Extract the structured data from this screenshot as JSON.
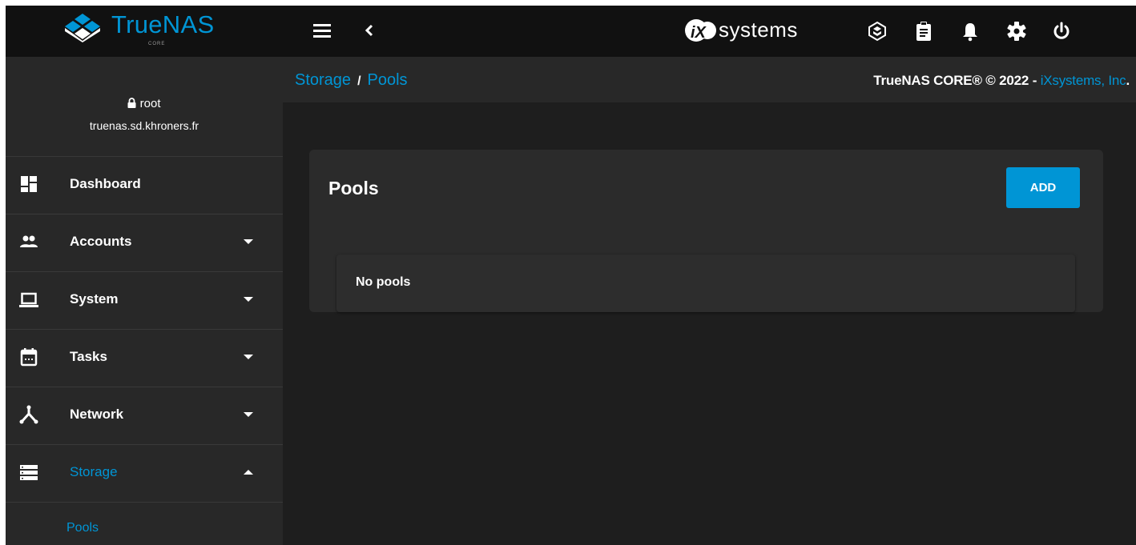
{
  "brand": {
    "name": "TrueNAS",
    "sub": "CORE"
  },
  "vendor_logo": {
    "text": "systems",
    "mark": "iX"
  },
  "topbar_icons": [
    "truecommand-icon",
    "clipboard-icon",
    "bell-icon",
    "gear-icon",
    "power-icon"
  ],
  "user": {
    "name": "root",
    "host": "truenas.sd.khroners.fr"
  },
  "sidebar": {
    "items": [
      {
        "label": "Dashboard",
        "icon": "dashboard-icon",
        "expandable": false
      },
      {
        "label": "Accounts",
        "icon": "people-icon",
        "expandable": true
      },
      {
        "label": "System",
        "icon": "laptop-icon",
        "expandable": true
      },
      {
        "label": "Tasks",
        "icon": "calendar-icon",
        "expandable": true
      },
      {
        "label": "Network",
        "icon": "network-icon",
        "expandable": true
      },
      {
        "label": "Storage",
        "icon": "storage-icon",
        "expandable": true,
        "expanded": true,
        "active": true
      }
    ],
    "sub_items": [
      {
        "label": "Pools"
      }
    ]
  },
  "breadcrumb": {
    "parent": "Storage",
    "separator": "/",
    "current": "Pools"
  },
  "copyright": {
    "text": "TrueNAS CORE® © 2022 - ",
    "link": "iXsystems, Inc",
    "trail": "."
  },
  "main": {
    "title": "Pools",
    "add_label": "ADD",
    "empty_message": "No pools"
  },
  "colors": {
    "accent": "#0095d5",
    "background": "#1e1e1e",
    "topbar": "#111111",
    "sidebar": "#282828"
  }
}
